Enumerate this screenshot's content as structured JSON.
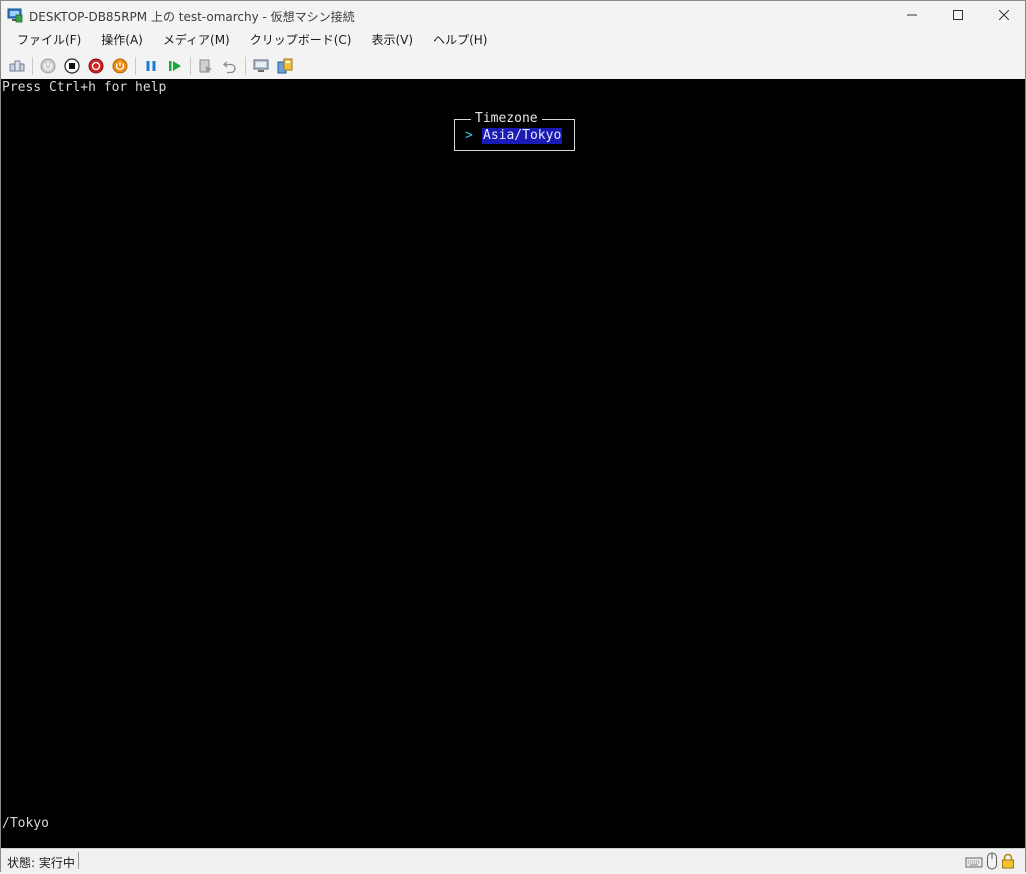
{
  "window": {
    "title": "DESKTOP-DB85RPM 上の test-omarchy  - 仮想マシン接続"
  },
  "menubar": {
    "items": [
      {
        "label": "ファイル(F)"
      },
      {
        "label": "操作(A)"
      },
      {
        "label": "メディア(M)"
      },
      {
        "label": "クリップボード(C)"
      },
      {
        "label": "表示(V)"
      },
      {
        "label": "ヘルプ(H)"
      }
    ]
  },
  "toolbar": {
    "icons": [
      "ctrl-alt-del-icon",
      "start-icon",
      "turn-off-icon",
      "shutdown-icon",
      "save-state-icon",
      "pause-icon",
      "resume-icon",
      "checkpoint-icon",
      "revert-icon",
      "enhanced-session-icon",
      "share-icon"
    ]
  },
  "console": {
    "help_text": "Press Ctrl+h for help",
    "dialog": {
      "title": "Timezone",
      "arrow": ">",
      "selected_option": "Asia/Tokyo"
    },
    "input_line": "/Tokyo"
  },
  "statusbar": {
    "status": "状態: 実行中",
    "icons": [
      "keyboard-icon",
      "mouse-icon",
      "lock-icon"
    ]
  },
  "colors": {
    "console_bg": "#000000",
    "selection_bg": "#1a1ab4",
    "arrow": "#38c8e6"
  }
}
